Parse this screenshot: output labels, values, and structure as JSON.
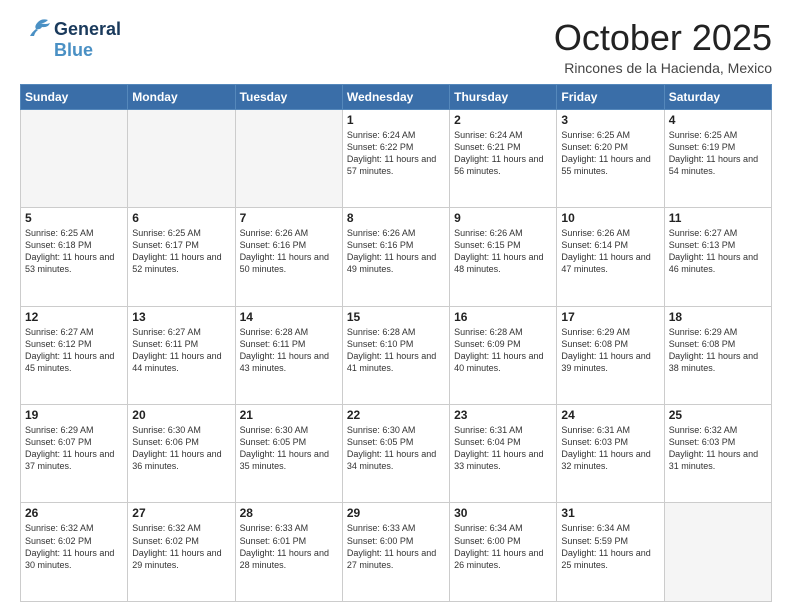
{
  "logo": {
    "line1": "General",
    "line2": "Blue"
  },
  "title": "October 2025",
  "subtitle": "Rincones de la Hacienda, Mexico",
  "days_of_week": [
    "Sunday",
    "Monday",
    "Tuesday",
    "Wednesday",
    "Thursday",
    "Friday",
    "Saturday"
  ],
  "weeks": [
    [
      {
        "day": "",
        "info": ""
      },
      {
        "day": "",
        "info": ""
      },
      {
        "day": "",
        "info": ""
      },
      {
        "day": "1",
        "info": "Sunrise: 6:24 AM\nSunset: 6:22 PM\nDaylight: 11 hours and 57 minutes."
      },
      {
        "day": "2",
        "info": "Sunrise: 6:24 AM\nSunset: 6:21 PM\nDaylight: 11 hours and 56 minutes."
      },
      {
        "day": "3",
        "info": "Sunrise: 6:25 AM\nSunset: 6:20 PM\nDaylight: 11 hours and 55 minutes."
      },
      {
        "day": "4",
        "info": "Sunrise: 6:25 AM\nSunset: 6:19 PM\nDaylight: 11 hours and 54 minutes."
      }
    ],
    [
      {
        "day": "5",
        "info": "Sunrise: 6:25 AM\nSunset: 6:18 PM\nDaylight: 11 hours and 53 minutes."
      },
      {
        "day": "6",
        "info": "Sunrise: 6:25 AM\nSunset: 6:17 PM\nDaylight: 11 hours and 52 minutes."
      },
      {
        "day": "7",
        "info": "Sunrise: 6:26 AM\nSunset: 6:16 PM\nDaylight: 11 hours and 50 minutes."
      },
      {
        "day": "8",
        "info": "Sunrise: 6:26 AM\nSunset: 6:16 PM\nDaylight: 11 hours and 49 minutes."
      },
      {
        "day": "9",
        "info": "Sunrise: 6:26 AM\nSunset: 6:15 PM\nDaylight: 11 hours and 48 minutes."
      },
      {
        "day": "10",
        "info": "Sunrise: 6:26 AM\nSunset: 6:14 PM\nDaylight: 11 hours and 47 minutes."
      },
      {
        "day": "11",
        "info": "Sunrise: 6:27 AM\nSunset: 6:13 PM\nDaylight: 11 hours and 46 minutes."
      }
    ],
    [
      {
        "day": "12",
        "info": "Sunrise: 6:27 AM\nSunset: 6:12 PM\nDaylight: 11 hours and 45 minutes."
      },
      {
        "day": "13",
        "info": "Sunrise: 6:27 AM\nSunset: 6:11 PM\nDaylight: 11 hours and 44 minutes."
      },
      {
        "day": "14",
        "info": "Sunrise: 6:28 AM\nSunset: 6:11 PM\nDaylight: 11 hours and 43 minutes."
      },
      {
        "day": "15",
        "info": "Sunrise: 6:28 AM\nSunset: 6:10 PM\nDaylight: 11 hours and 41 minutes."
      },
      {
        "day": "16",
        "info": "Sunrise: 6:28 AM\nSunset: 6:09 PM\nDaylight: 11 hours and 40 minutes."
      },
      {
        "day": "17",
        "info": "Sunrise: 6:29 AM\nSunset: 6:08 PM\nDaylight: 11 hours and 39 minutes."
      },
      {
        "day": "18",
        "info": "Sunrise: 6:29 AM\nSunset: 6:08 PM\nDaylight: 11 hours and 38 minutes."
      }
    ],
    [
      {
        "day": "19",
        "info": "Sunrise: 6:29 AM\nSunset: 6:07 PM\nDaylight: 11 hours and 37 minutes."
      },
      {
        "day": "20",
        "info": "Sunrise: 6:30 AM\nSunset: 6:06 PM\nDaylight: 11 hours and 36 minutes."
      },
      {
        "day": "21",
        "info": "Sunrise: 6:30 AM\nSunset: 6:05 PM\nDaylight: 11 hours and 35 minutes."
      },
      {
        "day": "22",
        "info": "Sunrise: 6:30 AM\nSunset: 6:05 PM\nDaylight: 11 hours and 34 minutes."
      },
      {
        "day": "23",
        "info": "Sunrise: 6:31 AM\nSunset: 6:04 PM\nDaylight: 11 hours and 33 minutes."
      },
      {
        "day": "24",
        "info": "Sunrise: 6:31 AM\nSunset: 6:03 PM\nDaylight: 11 hours and 32 minutes."
      },
      {
        "day": "25",
        "info": "Sunrise: 6:32 AM\nSunset: 6:03 PM\nDaylight: 11 hours and 31 minutes."
      }
    ],
    [
      {
        "day": "26",
        "info": "Sunrise: 6:32 AM\nSunset: 6:02 PM\nDaylight: 11 hours and 30 minutes."
      },
      {
        "day": "27",
        "info": "Sunrise: 6:32 AM\nSunset: 6:02 PM\nDaylight: 11 hours and 29 minutes."
      },
      {
        "day": "28",
        "info": "Sunrise: 6:33 AM\nSunset: 6:01 PM\nDaylight: 11 hours and 28 minutes."
      },
      {
        "day": "29",
        "info": "Sunrise: 6:33 AM\nSunset: 6:00 PM\nDaylight: 11 hours and 27 minutes."
      },
      {
        "day": "30",
        "info": "Sunrise: 6:34 AM\nSunset: 6:00 PM\nDaylight: 11 hours and 26 minutes."
      },
      {
        "day": "31",
        "info": "Sunrise: 6:34 AM\nSunset: 5:59 PM\nDaylight: 11 hours and 25 minutes."
      },
      {
        "day": "",
        "info": ""
      }
    ]
  ]
}
